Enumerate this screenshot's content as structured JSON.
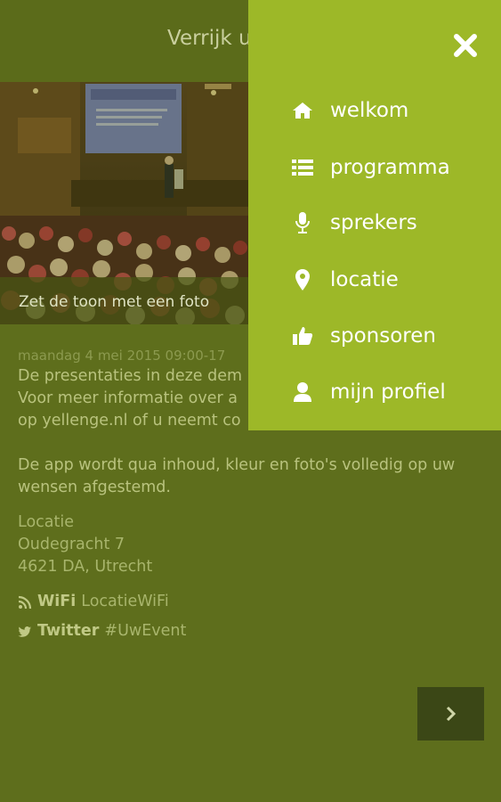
{
  "app": {
    "title": "Verrijk u"
  },
  "hero": {
    "caption": "Zet de toon met een foto",
    "slide_text": ""
  },
  "content": {
    "date": "maandag 4 mei 2015 09:00-17",
    "description_lines": [
      "De presentaties in deze dem",
      "Voor meer informatie over a",
      "op yellenge.nl of u neemt co"
    ],
    "paragraph2": "De app wordt qua inhoud, kleur en foto's volledig op uw wensen afgestemd.",
    "location_label": "Locatie",
    "address_line1": "Oudegracht 7",
    "address_line2": "4621 DA, Utrecht",
    "wifi_label": "WiFi",
    "wifi_value": "LocatieWiFi",
    "twitter_label": "Twitter",
    "twitter_value": "#UwEvent"
  },
  "menu": {
    "items": [
      {
        "label": "welkom",
        "icon": "home-icon"
      },
      {
        "label": "programma",
        "icon": "list-icon"
      },
      {
        "label": "sprekers",
        "icon": "microphone-icon"
      },
      {
        "label": "locatie",
        "icon": "map-marker-icon"
      },
      {
        "label": "sponsoren",
        "icon": "thumbs-up-icon"
      },
      {
        "label": "mijn profiel",
        "icon": "user-icon"
      }
    ]
  },
  "colors": {
    "menu_bg": "#9db828",
    "page_bg": "#5e6e1c",
    "next_button_bg": "#3b4716"
  }
}
